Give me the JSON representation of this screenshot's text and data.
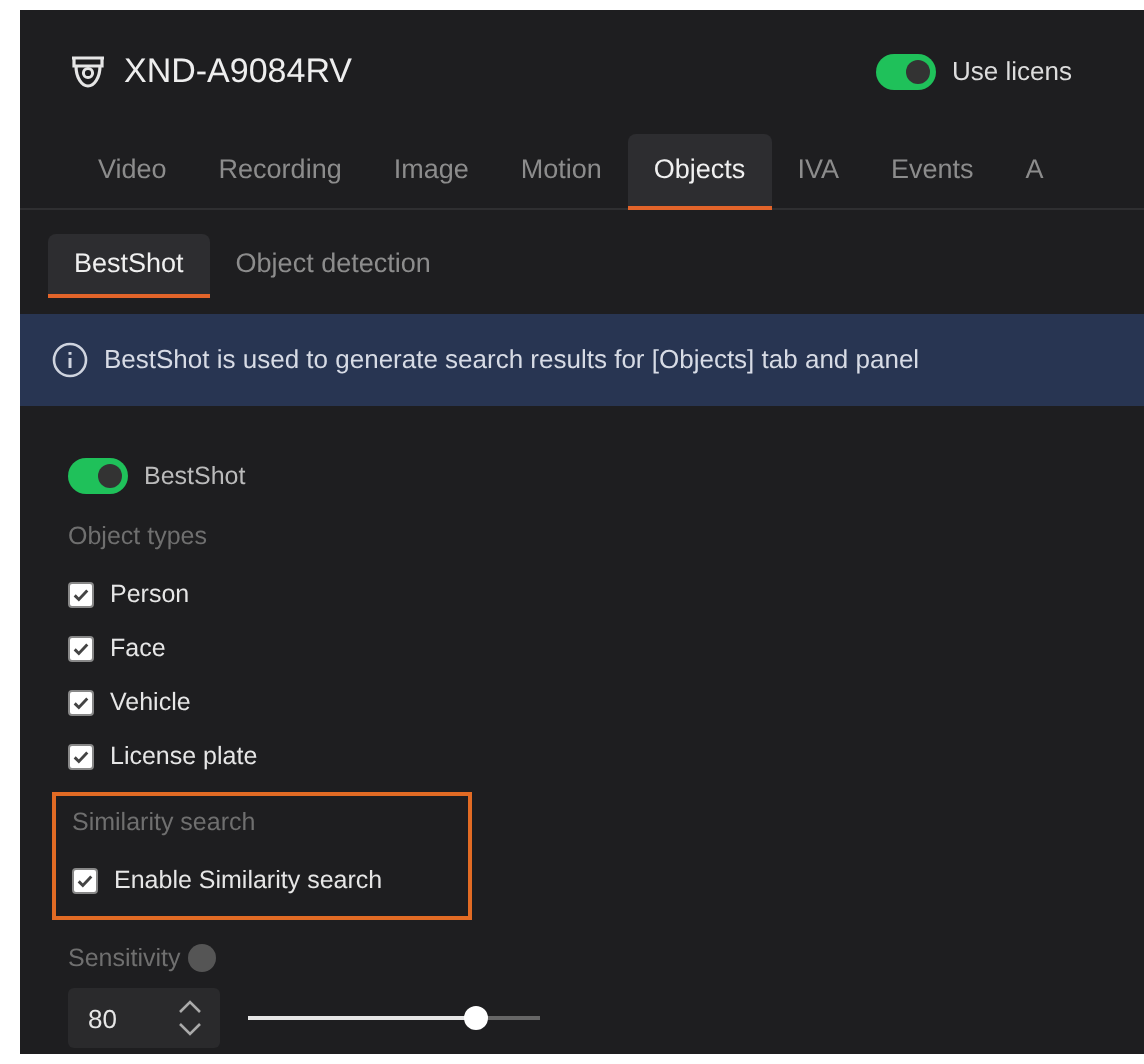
{
  "header": {
    "title": "XND-A9084RV",
    "license_toggle": {
      "label": "Use licens",
      "on": true
    }
  },
  "tabs": [
    {
      "label": "Video",
      "selected": false
    },
    {
      "label": "Recording",
      "selected": false
    },
    {
      "label": "Image",
      "selected": false
    },
    {
      "label": "Motion",
      "selected": false
    },
    {
      "label": "Objects",
      "selected": true
    },
    {
      "label": "IVA",
      "selected": false
    },
    {
      "label": "Events",
      "selected": false
    },
    {
      "label": "A",
      "selected": false
    }
  ],
  "subtabs": [
    {
      "label": "BestShot",
      "selected": true
    },
    {
      "label": "Object detection",
      "selected": false
    }
  ],
  "info_banner": "BestShot is used to generate search results for [Objects] tab and panel",
  "bestshot_toggle": {
    "label": "BestShot",
    "on": true
  },
  "object_types": {
    "label": "Object types",
    "items": [
      {
        "label": "Person",
        "checked": true
      },
      {
        "label": "Face",
        "checked": true
      },
      {
        "label": "Vehicle",
        "checked": true
      },
      {
        "label": "License plate",
        "checked": true
      }
    ]
  },
  "similarity": {
    "label": "Similarity search",
    "highlighted": true,
    "option": {
      "label": "Enable Similarity search",
      "checked": true
    }
  },
  "sensitivity": {
    "label": "Sensitivity",
    "value": "80",
    "level": 0.78
  }
}
